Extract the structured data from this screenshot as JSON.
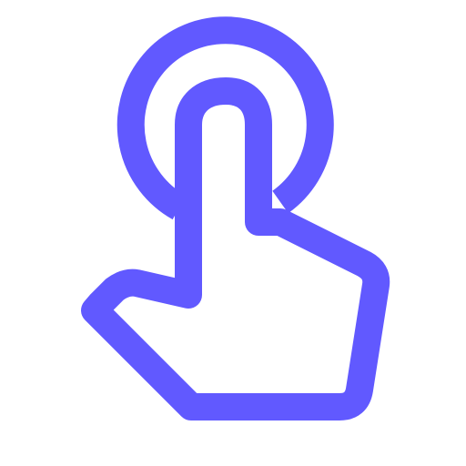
{
  "icon": {
    "name": "tap-gesture-icon",
    "color": "#6159FF",
    "background": "#FFFFFF"
  }
}
